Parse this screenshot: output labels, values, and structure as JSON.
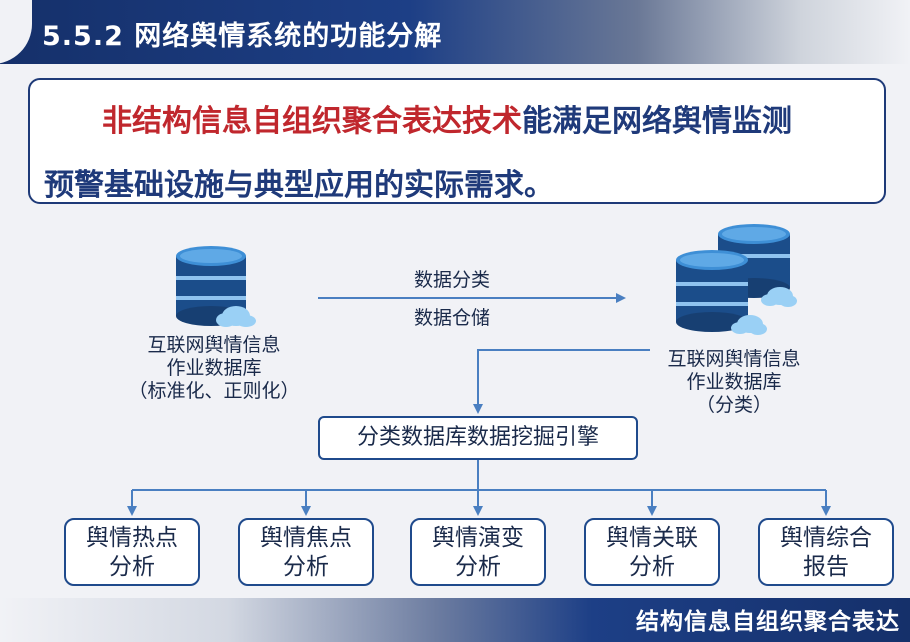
{
  "title": "5.5.2 网络舆情系统的功能分解",
  "intro": {
    "highlight": "非结构信息自组织聚合表达技术",
    "line1_rest": "能满足网络舆情监测",
    "line2": "预警基础设施与典型应用的实际需求。"
  },
  "left_db": {
    "line1": "互联网舆情信息",
    "line2": "作业数据库",
    "line3": "（标准化、正则化）"
  },
  "right_db": {
    "line1": "互联网舆情信息",
    "line2": "作业数据库",
    "line3": "（分类）"
  },
  "arrow_labels": {
    "top": "数据分类",
    "bottom": "数据仓储"
  },
  "engine": "分类数据库数据挖掘引擎",
  "outputs": [
    {
      "line1": "舆情热点",
      "line2": "分析"
    },
    {
      "line1": "舆情焦点",
      "line2": "分析"
    },
    {
      "line1": "舆情演变",
      "line2": "分析"
    },
    {
      "line1": "舆情关联",
      "line2": "分析"
    },
    {
      "line1": "舆情综合",
      "line2": "报告"
    }
  ],
  "footer": "结构信息自组织聚合表达",
  "colors": {
    "navy": "#1d3f86",
    "highlight_red": "#c0272d",
    "text_blue": "#1f3a7a",
    "line_blue": "#4a7fc1"
  },
  "icons": {
    "database": "database-cloud-icon"
  }
}
